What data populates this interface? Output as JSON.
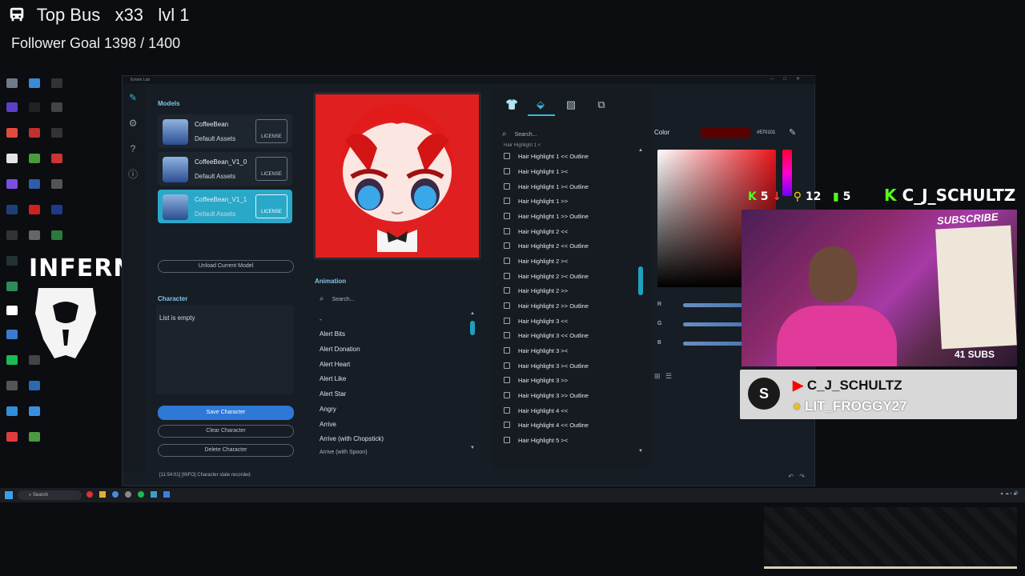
{
  "overlay": {
    "title": "Top Bus",
    "multiplier": "x33",
    "level": "lvl 1",
    "follower_goal": "Follower Goal 1398 / 1400"
  },
  "desktop": {
    "brand_text": "INFERNO"
  },
  "window": {
    "title": "Emote Lab",
    "models_title": "Models",
    "models": [
      {
        "name": "CoffeeBean",
        "sub": "Default Assets",
        "license": "LICENSE",
        "active": false
      },
      {
        "name": "CoffeeBean_V1_0",
        "sub": "Default Assets",
        "license": "LICENSE",
        "active": false
      },
      {
        "name": "CoffeeBean_V1_1",
        "sub": "Default Assets",
        "license": "LICENSE",
        "active": true
      }
    ],
    "unload_label": "Unload Current Model",
    "character_title": "Character",
    "character_empty": "List is empty",
    "save_label": "Save Character",
    "clear_label": "Clear Character",
    "delete_label": "Delete Character",
    "animation_title": "Animation",
    "animation_search": "Search...",
    "animations": [
      "-",
      "Alert Bits",
      "Alert Donation",
      "Alert Heart",
      "Alert Like",
      "Alert Star",
      "Angry",
      "Arrive",
      "Arrive (with Chopstick)",
      "Arrive (with Spoon)"
    ],
    "options_search": "Search...",
    "options": [
      "Hair Highlight 1 <",
      "Hair Highlight 1 << Outline",
      "Hair Highlight 1 ><",
      "Hair Highlight 1 >< Outline",
      "Hair Highlight 1 >>",
      "Hair Highlight 1 >> Outline",
      "Hair Highlight 2 <<",
      "Hair Highlight 2 << Outline",
      "Hair Highlight 2 ><",
      "Hair Highlight 2 >< Outline",
      "Hair Highlight 2 >>",
      "Hair Highlight 2 >> Outline",
      "Hair Highlight 3 <<",
      "Hair Highlight 3 << Outline",
      "Hair Highlight 3 ><",
      "Hair Highlight 3 >< Outline",
      "Hair Highlight 3 >>",
      "Hair Highlight 3 >> Outline",
      "Hair Highlight 4 <<",
      "Hair Highlight 4 << Outline",
      "Hair Highlight 5 ><"
    ],
    "color_label": "Color",
    "color_hex": "#570101",
    "channel_r": "R",
    "channel_g": "G",
    "channel_b": "B",
    "status": "[11:54:01] [INFO] Character state recorded"
  },
  "stream": {
    "kick_count": "5",
    "follow_count": "12",
    "viewer_count": "5",
    "kick_name": "C_J_SCHULTZ",
    "subs": "41 SUBS",
    "youtube_name": "C_J_SCHULTZ",
    "sub_name": "LIT_FROGGY27",
    "subscribe_text": "SUBSCRIBE"
  },
  "taskbar": {
    "search_placeholder": "Search"
  },
  "colors": {
    "accent": "#29a8c8",
    "save_button": "#2e78d6",
    "selected_color": "#570101"
  }
}
